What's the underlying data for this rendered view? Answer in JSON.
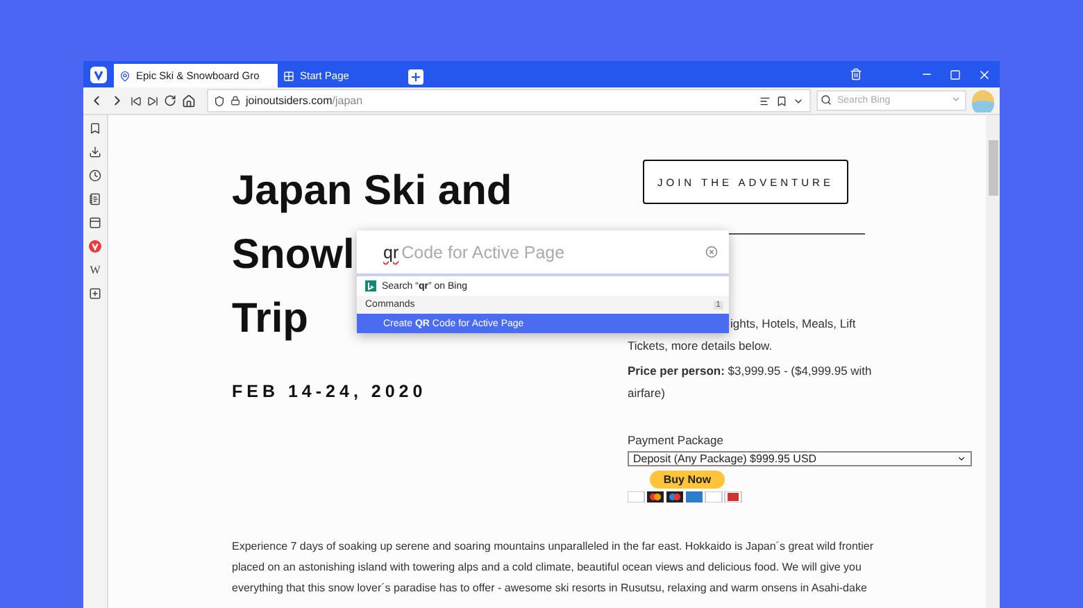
{
  "tabs": [
    {
      "title": "Epic Ski & Snowboard Gro",
      "selected": true,
      "kind": "site"
    },
    {
      "title": "Start Page",
      "selected": false,
      "kind": "grid"
    }
  ],
  "address_bar": {
    "host": "joinoutsiders.com",
    "path": "/japan"
  },
  "search": {
    "placeholder": "Search Bing"
  },
  "sidebar": {
    "items": [
      {
        "kind": "bookmarks"
      },
      {
        "kind": "downloads"
      },
      {
        "kind": "history"
      },
      {
        "kind": "notes"
      },
      {
        "kind": "window"
      },
      {
        "kind": "vivaldi"
      },
      {
        "kind": "wiki",
        "glyph": "W"
      },
      {
        "kind": "add"
      }
    ]
  },
  "page": {
    "title_lines": [
      "Japan Ski and",
      "Snowl",
      "Trip"
    ],
    "date": "FEB 14-24, 2020",
    "cta": "JOIN THE ADVENTURE",
    "includes": [
      "ights, Hotels, Meals, Lift",
      "Tickets, more details below."
    ],
    "price": [
      "**Price per person:** $3,999.95 - ($4,999.95  with",
      "airfare)"
    ],
    "payment_label": "Payment Package",
    "payment_select": "Deposit (Any Package) $999.95 USD",
    "buy_button": "Buy Now",
    "paragraph": "Experience 7 days of soaking up serene and soaring mountains unparalleled in the far east. Hokkaido is Japan´s great wild frontier placed on an astonishing island with towering alps and a cold climate, beautiful ocean views and delicious food. We will give you everything that this snow lover´s paradise has to offer - awesome ski resorts in Rusutsu, relaxing and warm onsens in Asahi-dake"
  },
  "quick_commands": {
    "typed": "qr",
    "completion": "Code for Active Page",
    "results": [
      {
        "kind": "search",
        "label": "Search “**qr**” on Bing",
        "selected": false
      },
      {
        "kind": "header",
        "label": "Commands",
        "count": "1"
      },
      {
        "kind": "command",
        "label": "Create **QR** Code for Active Page",
        "selected": true
      }
    ]
  }
}
